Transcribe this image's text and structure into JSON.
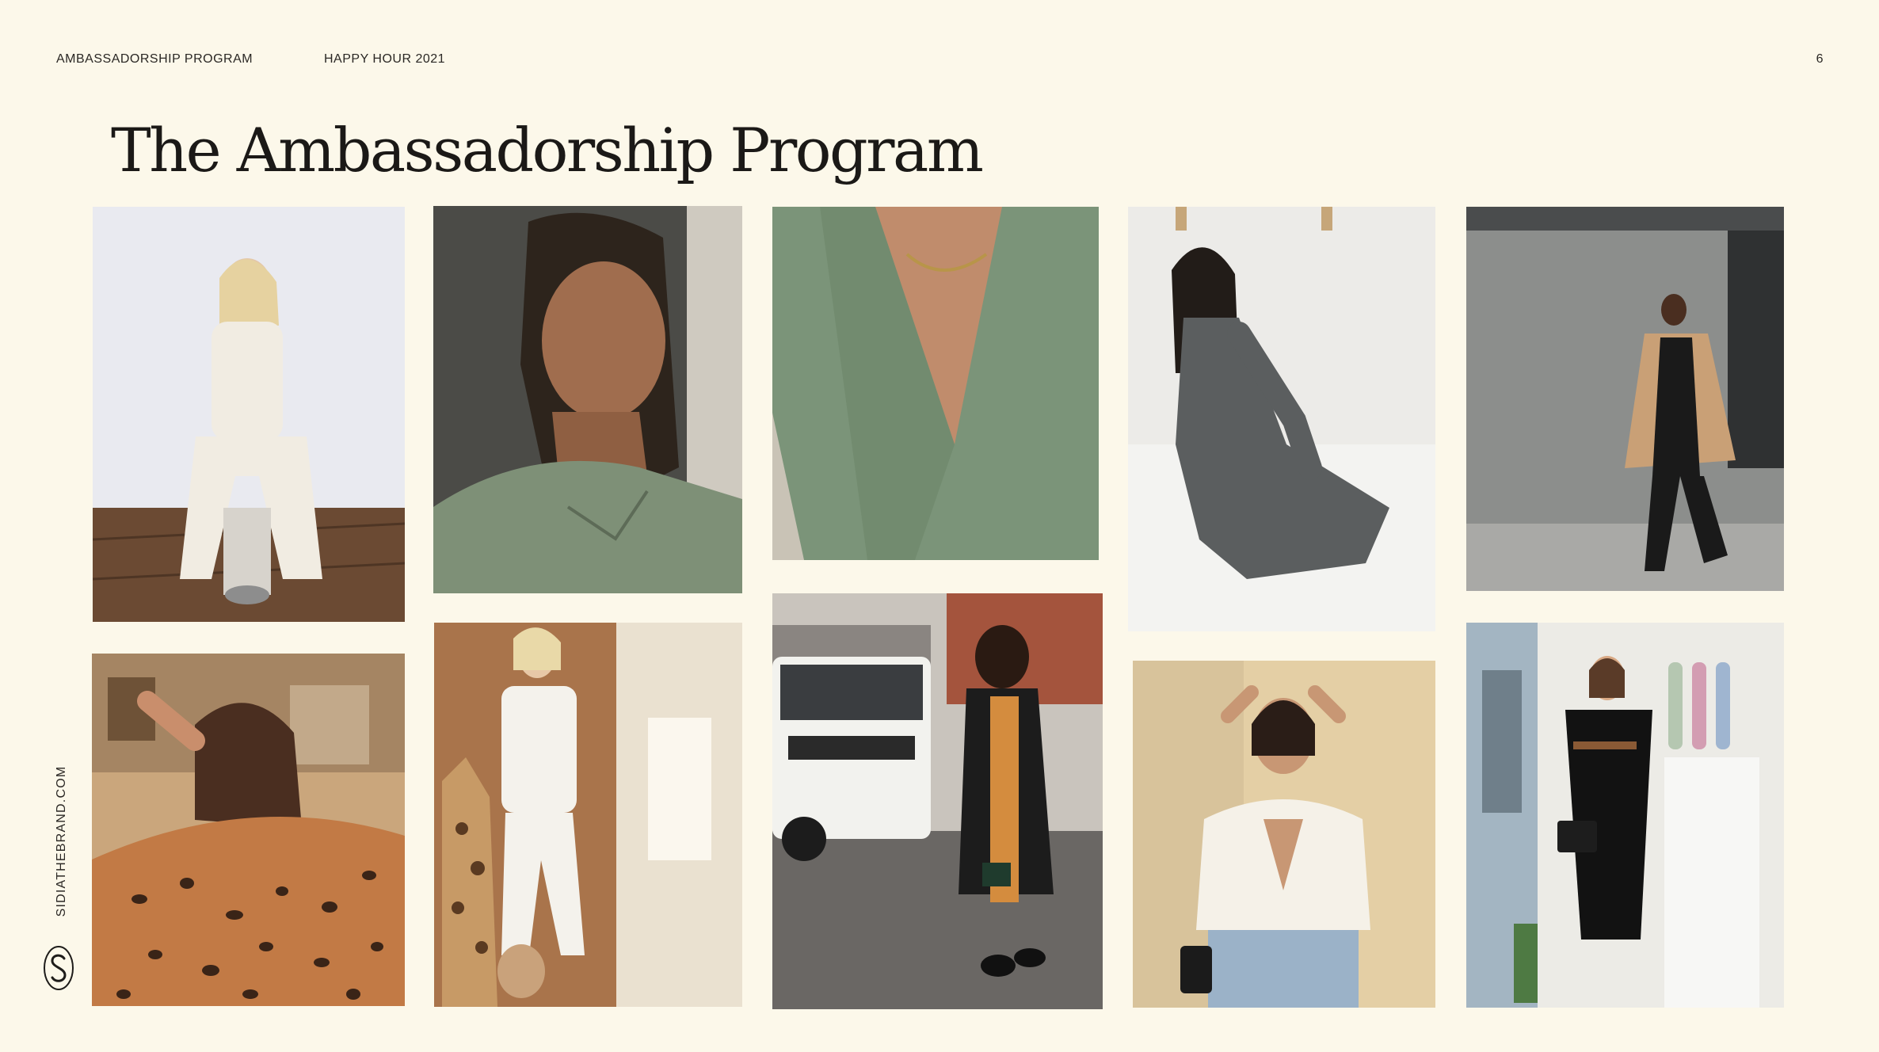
{
  "header": {
    "left": "AMBASSADORSHIP PROGRAM",
    "center": "HAPPY HOUR 2021",
    "page_number": "6"
  },
  "title": "The Ambassadorship Program",
  "sidebar": {
    "url": "SIDIATHEBRAND.COM",
    "logo_icon": "sidia-s-logo-icon"
  },
  "photos": [
    {
      "name": "photo-blonde-cream-set",
      "palette": [
        "#e9eaf0",
        "#6b4a33",
        "#f1ece2"
      ]
    },
    {
      "name": "photo-braids-green-top",
      "palette": [
        "#4b4b47",
        "#a06d4e",
        "#7e9077"
      ]
    },
    {
      "name": "photo-green-vneck-closeup",
      "palette": [
        "#d8d2c6",
        "#7b9479",
        "#c08c6c"
      ]
    },
    {
      "name": "photo-grey-set-on-bed",
      "palette": [
        "#ecebe8",
        "#f3f3f1",
        "#5b5e5f"
      ]
    },
    {
      "name": "photo-camel-coat-wall",
      "palette": [
        "#8c8e8c",
        "#c9a076",
        "#1a1a1a"
      ]
    },
    {
      "name": "photo-leopard-print-top",
      "palette": [
        "#caa67c",
        "#c27a45",
        "#3a2417"
      ]
    },
    {
      "name": "photo-mirror-cream-set",
      "palette": [
        "#a9744b",
        "#f4f2ec",
        "#c79a66"
      ]
    },
    {
      "name": "photo-street-range-rover",
      "palette": [
        "#c9c4bd",
        "#f2f2ee",
        "#d48c3e"
      ]
    },
    {
      "name": "photo-white-cardigan-jeans",
      "palette": [
        "#e4cfa5",
        "#f5f1e8",
        "#9bb2c8"
      ]
    },
    {
      "name": "photo-black-dress-mirror",
      "palette": [
        "#ecebe6",
        "#a3b5c2",
        "#121212"
      ]
    }
  ]
}
